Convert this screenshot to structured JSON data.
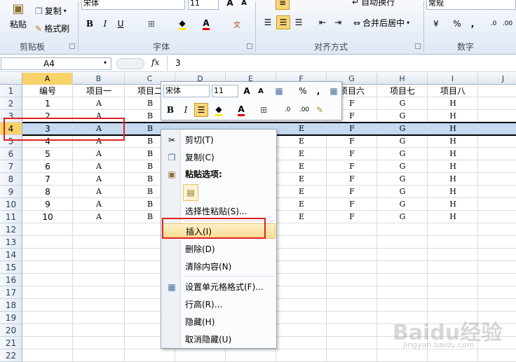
{
  "ribbon": {
    "clipboard": {
      "paste": "粘贴",
      "copy": "复制",
      "format_painter": "格式刷",
      "label": "剪贴板"
    },
    "font": {
      "name": "宋体",
      "size": "11",
      "label": "字体",
      "bold": "B",
      "italic": "I",
      "underline": "U"
    },
    "alignment": {
      "wrap": "自动换行",
      "merge": "合并后居中",
      "label": "对齐方式"
    },
    "number": {
      "format": "常规",
      "percent": "%",
      "comma": ",",
      "label": "数字"
    }
  },
  "formula_bar": {
    "name_box": "A4",
    "fx": "fx",
    "value": "3"
  },
  "columns": [
    "A",
    "B",
    "C",
    "D",
    "E",
    "F",
    "G",
    "H",
    "I",
    "J"
  ],
  "rows": [
    "1",
    "2",
    "3",
    "4",
    "5",
    "6",
    "7",
    "8",
    "9",
    "10",
    "11",
    "12",
    "13",
    "14",
    "15",
    "16",
    "17",
    "18",
    "19",
    "20",
    "21",
    "22"
  ],
  "headers": [
    "编号",
    "项目一",
    "项目二",
    "",
    "",
    "",
    "项目六",
    "项目七",
    "项目八"
  ],
  "data_rows": [
    [
      "1",
      "A",
      "B",
      "",
      "",
      "F",
      "G",
      "H"
    ],
    [
      "2",
      "A",
      "B",
      "",
      "",
      "F",
      "G",
      "H"
    ],
    [
      "3",
      "A",
      "B",
      "",
      "",
      "F",
      "G",
      "H"
    ],
    [
      "4",
      "A",
      "B",
      "",
      "",
      "F",
      "G",
      "H"
    ],
    [
      "5",
      "A",
      "B",
      "",
      "",
      "F",
      "G",
      "H"
    ],
    [
      "6",
      "A",
      "B",
      "",
      "",
      "F",
      "G",
      "H"
    ],
    [
      "7",
      "A",
      "B",
      "",
      "",
      "F",
      "G",
      "H"
    ],
    [
      "8",
      "A",
      "B",
      "",
      "",
      "F",
      "G",
      "H"
    ],
    [
      "9",
      "A",
      "B",
      "",
      "",
      "F",
      "G",
      "H"
    ],
    [
      "10",
      "A",
      "B",
      "",
      "",
      "F",
      "G",
      "H"
    ]
  ],
  "col_e_partial": [
    "E",
    "E",
    "E",
    "E",
    "E",
    "E",
    "E",
    "E",
    "E",
    "E"
  ],
  "mini_toolbar": {
    "font": "宋体",
    "size": "11",
    "percent": "%",
    "comma": ",",
    "bold": "B",
    "italic": "I"
  },
  "context_menu": {
    "cut": "剪切(T)",
    "copy": "复制(C)",
    "paste_options": "粘贴选项:",
    "paste_special": "选择性粘贴(S)...",
    "insert": "插入(I)",
    "delete": "删除(D)",
    "clear": "清除内容(N)",
    "format_cells": "设置单元格格式(F)...",
    "row_height": "行高(R)...",
    "hide": "隐藏(H)",
    "unhide": "取消隐藏(U)"
  },
  "watermark": {
    "brand": "Baidu经验",
    "url": "jingyan.baidu.com"
  },
  "colors": {
    "selection": "#c5d9f1",
    "highlight_header": "#f8d36a",
    "red_outline": "#e02020"
  }
}
